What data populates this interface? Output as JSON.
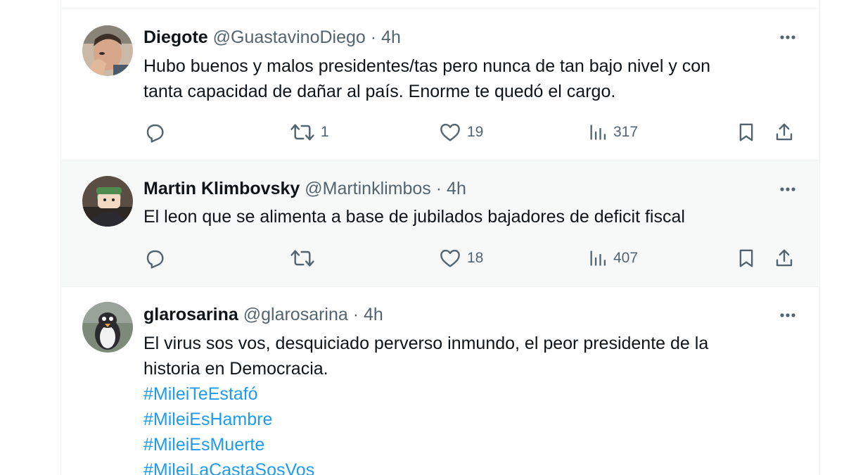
{
  "tweets": [
    {
      "name": "Diegote",
      "handle": "@GuastavinoDiego",
      "dot": "·",
      "time": "4h",
      "text_lines": [
        "Hubo buenos y malos presidentes/tas pero nunca de tan bajo nivel y con",
        "tanta capacidad de dañar al país. Enorme te quedó el cargo."
      ],
      "hashtags": [],
      "retweets": "1",
      "likes": "19",
      "views": "317"
    },
    {
      "name": "Martin Klimbovsky",
      "handle": "@Martinklimbos",
      "dot": "·",
      "time": "4h",
      "text_lines": [
        "El leon que se alimenta a base de jubilados bajadores de deficit fiscal"
      ],
      "hashtags": [],
      "retweets": "",
      "likes": "18",
      "views": "407"
    },
    {
      "name": "glarosarina",
      "handle": "@glarosarina",
      "dot": "·",
      "time": "4h",
      "text_lines": [
        "El virus sos vos, desquiciado perverso inmundo, el peor presidente de la",
        "historia en Democracia."
      ],
      "hashtags": [
        "#MileiTeEstafó",
        "#MileiEsHambre",
        "#MileiEsMuerte",
        "#MileiLaCastaSosVos"
      ]
    }
  ],
  "icons": {
    "more": "more-icon",
    "reply": "reply-icon",
    "retweet": "retweet-icon",
    "like": "like-icon",
    "views": "views-icon",
    "bookmark": "bookmark-icon",
    "share": "share-icon"
  },
  "colors": {
    "text": "#0f1419",
    "secondary": "#536471",
    "hashtag": "#1d9bf0",
    "highlight_bg": "#f7f9f9",
    "border": "#eff3f4"
  }
}
